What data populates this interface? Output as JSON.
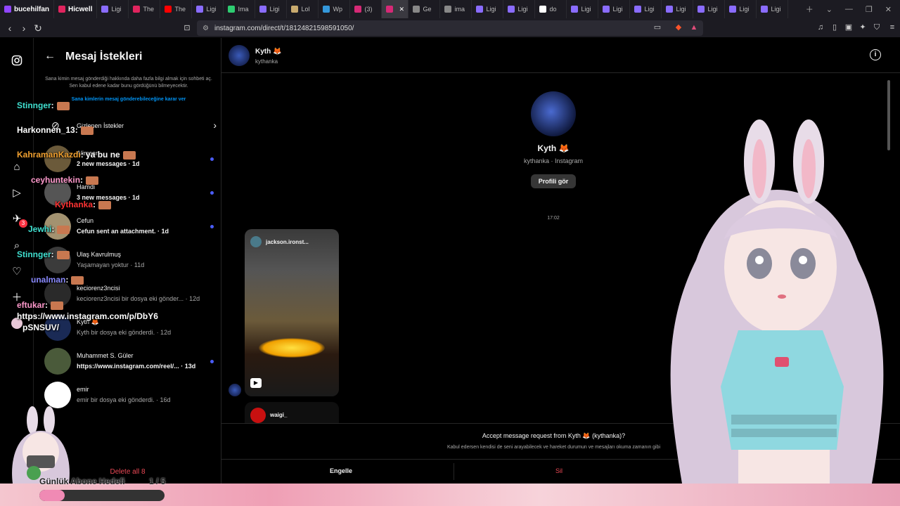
{
  "tabs": [
    {
      "label": "bucehilfan",
      "color": "#9146ff",
      "wide": true
    },
    {
      "label": "Hicwell",
      "color": "#e0245e",
      "wide": true
    },
    {
      "label": "Ligi",
      "color": "#8a6cff"
    },
    {
      "label": "The",
      "color": "#e0245e"
    },
    {
      "label": "The",
      "color": "#ff0000"
    },
    {
      "label": "Ligi",
      "color": "#8a6cff"
    },
    {
      "label": "Ima",
      "color": "#2ecc71"
    },
    {
      "label": "Ligi",
      "color": "#8a6cff"
    },
    {
      "label": "Lol",
      "color": "#c8aa6e"
    },
    {
      "label": "Wp",
      "color": "#3498db"
    },
    {
      "label": "(3)",
      "color": "#d62976"
    },
    {
      "label": "",
      "color": "#d62976",
      "active": true
    },
    {
      "label": "Ge",
      "color": "#888888"
    },
    {
      "label": "ima",
      "color": "#888888"
    },
    {
      "label": "Ligi",
      "color": "#8a6cff"
    },
    {
      "label": "Ligi",
      "color": "#8a6cff"
    },
    {
      "label": "do",
      "color": "#ffffff"
    },
    {
      "label": "Ligi",
      "color": "#8a6cff"
    },
    {
      "label": "Ligi",
      "color": "#8a6cff"
    },
    {
      "label": "Ligi",
      "color": "#8a6cff"
    },
    {
      "label": "Ligi",
      "color": "#8a6cff"
    },
    {
      "label": "Ligi",
      "color": "#8a6cff"
    },
    {
      "label": "Ligi",
      "color": "#8a6cff"
    },
    {
      "label": "Ligi",
      "color": "#8a6cff"
    }
  ],
  "address": {
    "url": "instagram.com/direct/t/18124821598591050/"
  },
  "inbox": {
    "title": "Mesaj İstekleri",
    "info": "Sana kimin mesaj gönderdiği hakkında daha fazla bilgi almak için sohbeti aç. Sen kabul edene kadar bunu gördüğünü bilmeyecektir.",
    "link": "Sana kimlerin mesaj gönderebileceğine karar ver",
    "hidden_label": "Gizlenen İstekler",
    "conversations": [
      {
        "name": "Alimcan",
        "preview": "2 new messages · 1d",
        "bold": true,
        "unread": true,
        "color": "#6b5a3a"
      },
      {
        "name": "Hamdi",
        "preview": "3 new messages · 1d",
        "bold": true,
        "unread": true,
        "color": "#555555"
      },
      {
        "name": "Cefun",
        "preview": "Cefun sent an attachment. · 1d",
        "bold": true,
        "unread": true,
        "color": "#a39270"
      },
      {
        "name": "Ulaş Kavrulmuş",
        "preview": "Yaşamayan yoktur · 11d",
        "bold": false,
        "unread": false,
        "color": "#3b3b3b"
      },
      {
        "name": "keciorenz3ncisi",
        "preview": "keciorenz3ncisi bir dosya eki gönder... · 12d",
        "bold": false,
        "unread": false,
        "color": "#2a2a2a"
      },
      {
        "name": "Kyth 🦊",
        "preview": "Kyth bir dosya eki gönderdi. · 12d",
        "bold": false,
        "unread": false,
        "color": "#1a2a55"
      },
      {
        "name": "Muhammet S. Güler",
        "preview": "https://www.instagram.com/reel/... · 13d",
        "bold": true,
        "unread": true,
        "color": "#4a5a3a"
      },
      {
        "name": "emir",
        "preview": "emir bir dosya eki gönderdi. · 16d",
        "bold": false,
        "unread": false,
        "color": "#ffffff"
      }
    ],
    "delete_all": "Delete all 8"
  },
  "convo": {
    "header_name": "Kyth 🦊",
    "header_user": "kythanka",
    "profile_name": "Kyth 🦊",
    "profile_sub": "kythanka · Instagram",
    "profile_button": "Profili gör",
    "time": "17:02",
    "reel1_user": "jackson.ironst...",
    "reel2_user": "waigi_",
    "accept_text": "Accept message request from Kyth 🦊 (kythanka)?",
    "accept_sub": "Kabul edersen kendisi de seni arayabilecek ve hareket durumun ve mesajları okuma zamanın gibi",
    "block": "Engelle",
    "delete": "Sil"
  },
  "chat": [
    {
      "user": "Stinnger",
      "msg": ":",
      "color": "#40e0d0"
    },
    {
      "user": "Harkonnen_13",
      "msg": ":",
      "color": "#ffffff"
    },
    {
      "user": "KahramanKazdı",
      "msg": ": ya bu ne",
      "color": "#f0a030"
    },
    {
      "user": "ceyhuntekin",
      "msg": ":",
      "color": "#ff99cc"
    },
    {
      "user": "Kythanka",
      "msg": ":",
      "color": "#ff3333"
    },
    {
      "user": "Jewhi",
      "msg": ":",
      "color": "#40e0d0"
    },
    {
      "user": "Stinnger",
      "msg": ":",
      "color": "#40e0d0"
    },
    {
      "user": "unalman",
      "msg": ":",
      "color": "#8a8aff"
    },
    {
      "user": "eftukar",
      "msg": ":",
      "color": "#ff99cc"
    },
    {
      "user": "",
      "msg": "https://www.instagram.com/p/DbY6",
      "color": "#ffffff"
    },
    {
      "user": "",
      "msg": "pSNSUV/",
      "color": "#ffffff"
    }
  ],
  "goal": {
    "label": "Günlük Abone Hedefi",
    "count": "1 / 5",
    "progress": 0.2
  },
  "badge_count": "3"
}
